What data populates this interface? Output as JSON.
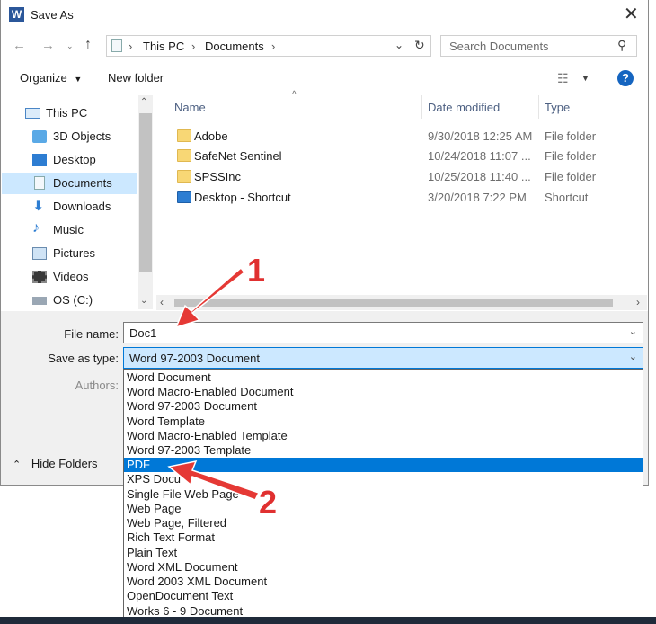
{
  "window": {
    "title": "Save As",
    "app_icon": "W"
  },
  "nav": {
    "back": "←",
    "forward": "→",
    "up": "↑",
    "refresh": "↻"
  },
  "breadcrumb": {
    "parts": [
      "This PC",
      "Documents"
    ]
  },
  "search": {
    "placeholder": "Search Documents"
  },
  "toolbar": {
    "organize": "Organize",
    "new_folder": "New folder",
    "help": "?"
  },
  "sidebar": {
    "items": [
      {
        "label": "This PC"
      },
      {
        "label": "3D Objects"
      },
      {
        "label": "Desktop"
      },
      {
        "label": "Documents"
      },
      {
        "label": "Downloads"
      },
      {
        "label": "Music"
      },
      {
        "label": "Pictures"
      },
      {
        "label": "Videos"
      },
      {
        "label": "OS (C:)"
      }
    ],
    "selected": "Documents"
  },
  "files": {
    "columns": [
      "Name",
      "Date modified",
      "Type"
    ],
    "rows": [
      {
        "name": "Adobe",
        "date": "9/30/2018 12:25 AM",
        "type": "File folder"
      },
      {
        "name": "SafeNet Sentinel",
        "date": "10/24/2018 11:07 ...",
        "type": "File folder"
      },
      {
        "name": "SPSSInc",
        "date": "10/25/2018 11:40 ...",
        "type": "File folder"
      },
      {
        "name": "Desktop - Shortcut",
        "date": "3/20/2018 7:22 PM",
        "type": "Shortcut"
      }
    ]
  },
  "form": {
    "file_name_label": "File name:",
    "file_name_value": "Doc1",
    "save_type_label": "Save as type:",
    "save_type_value": "Word 97-2003 Document",
    "authors_label": "Authors:",
    "hide_folders": "Hide Folders"
  },
  "type_options": [
    "Word Document",
    "Word Macro-Enabled Document",
    "Word 97-2003 Document",
    "Word Template",
    "Word Macro-Enabled Template",
    "Word 97-2003 Template",
    "PDF",
    "XPS Docu",
    "Single File Web Page",
    "Web Page",
    "Web Page, Filtered",
    "Rich Text Format",
    "Plain Text",
    "Word XML Document",
    "Word 2003 XML Document",
    "OpenDocument Text",
    "Works 6 - 9 Document"
  ],
  "highlighted_option": "PDF",
  "annotations": {
    "step1": "1",
    "step2": "2"
  },
  "colors": {
    "accent": "#0078d7",
    "selection": "#cce8ff",
    "annotation": "#e03030"
  }
}
